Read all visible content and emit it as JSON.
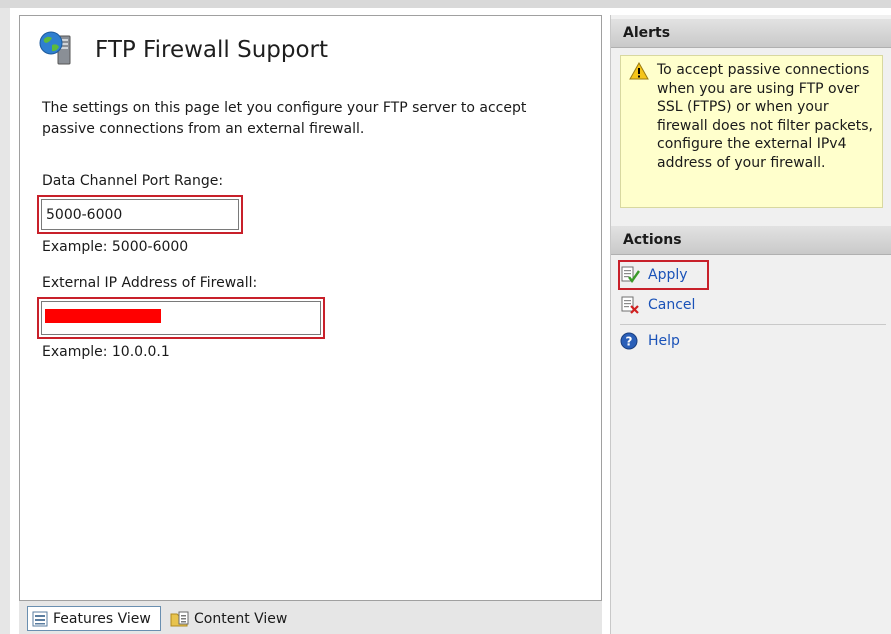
{
  "page": {
    "title": "FTP Firewall Support",
    "description": "The settings on this page let you configure your FTP server to accept passive connections from an external firewall."
  },
  "port_range": {
    "label": "Data Channel Port Range:",
    "value": "5000-6000",
    "example": "Example: 5000-6000"
  },
  "external_ip": {
    "label": "External IP Address of Firewall:",
    "value": "",
    "example": "Example: 10.0.0.1"
  },
  "views": {
    "features": "Features View",
    "content": "Content View"
  },
  "alerts": {
    "header": "Alerts",
    "message": "To accept passive connections when you are using FTP over SSL (FTPS) or when your firewall does not filter packets, configure the external IPv4 address of your firewall."
  },
  "actions": {
    "header": "Actions",
    "apply": "Apply",
    "cancel": "Cancel",
    "help": "Help"
  },
  "colors": {
    "highlight": "#c8202a",
    "link": "#1a52b8",
    "alert_bg": "#ffffcc",
    "redaction": "#ff0000"
  },
  "icons": [
    "globe-server-icon",
    "features-view-icon",
    "content-view-icon",
    "warning-icon",
    "apply-icon",
    "cancel-icon",
    "help-icon"
  ]
}
